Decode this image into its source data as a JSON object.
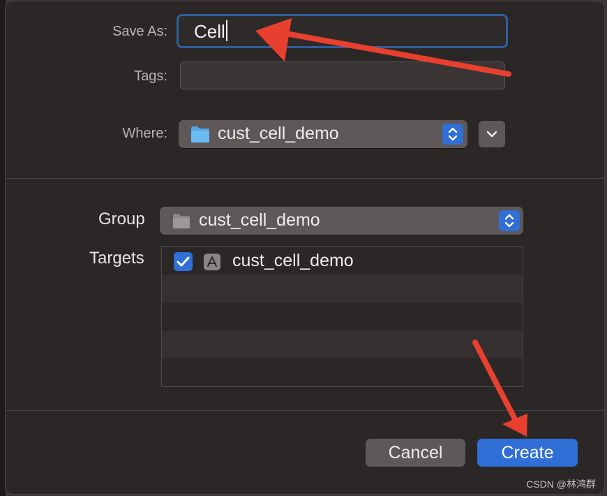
{
  "form": {
    "save_as_label": "Save As:",
    "save_as_value": "Cell",
    "tags_label": "Tags:",
    "tags_value": "",
    "where_label": "Where:",
    "where_value": "cust_cell_demo"
  },
  "group": {
    "label": "Group",
    "value": "cust_cell_demo"
  },
  "targets": {
    "label": "Targets",
    "items": [
      {
        "name": "cust_cell_demo",
        "checked": true
      }
    ]
  },
  "buttons": {
    "cancel": "Cancel",
    "create": "Create"
  },
  "watermark": "CSDN @林鸿群",
  "colors": {
    "accent": "#2f6fd6",
    "annotation_arrow": "#e8402f",
    "background": "#2c2727"
  },
  "icons": {
    "folder": "folder-icon",
    "app": "app-target-icon",
    "checkbox": "checkmark-icon",
    "stepper": "up-down-chevron-icon",
    "expand": "chevron-down-icon"
  }
}
